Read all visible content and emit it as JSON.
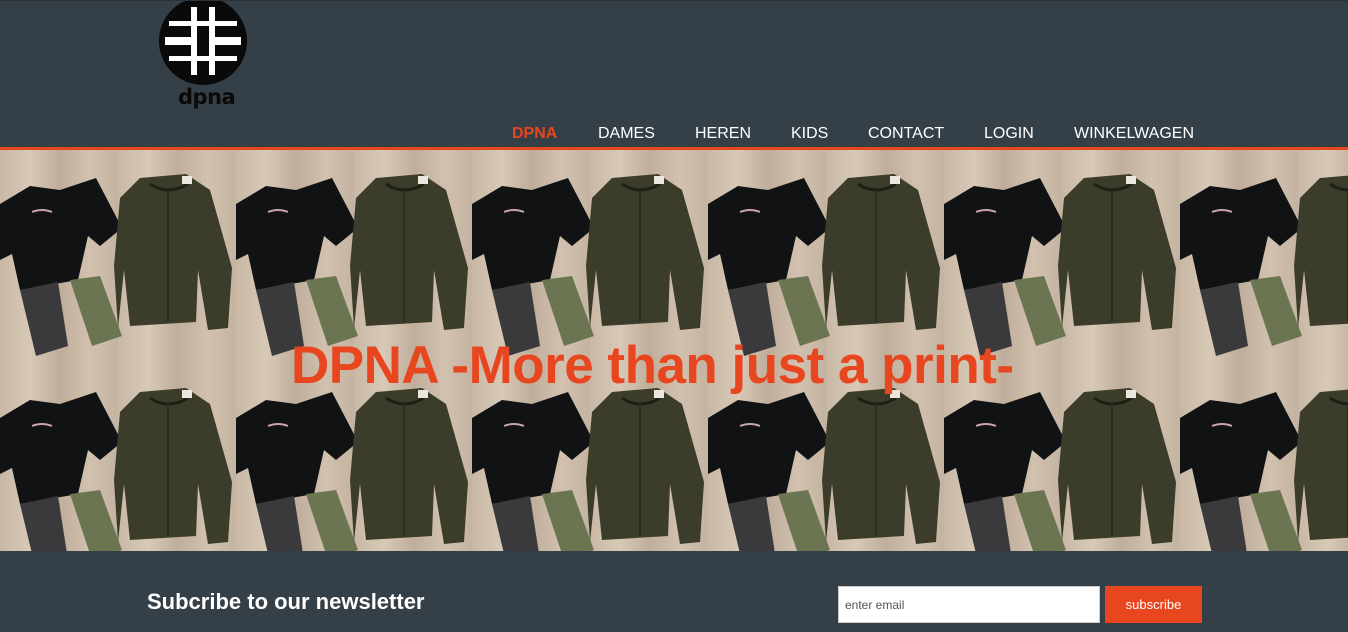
{
  "header": {
    "logo_text": "dpna"
  },
  "nav": {
    "items": [
      {
        "label": "DPNA",
        "active": true
      },
      {
        "label": "DAMES"
      },
      {
        "label": "HEREN"
      },
      {
        "label": "KIDS"
      },
      {
        "label": "CONTACT"
      },
      {
        "label": "LOGIN"
      },
      {
        "label": "WINKELWAGEN"
      }
    ]
  },
  "hero": {
    "title": "DPNA -More than just a print-"
  },
  "newsletter": {
    "title": "Subcribe to our newsletter",
    "email_placeholder": "enter email",
    "subscribe_label": "subscribe"
  },
  "colors": {
    "accent": "#e8461e",
    "background": "#343f48",
    "text": "#ffffff"
  }
}
